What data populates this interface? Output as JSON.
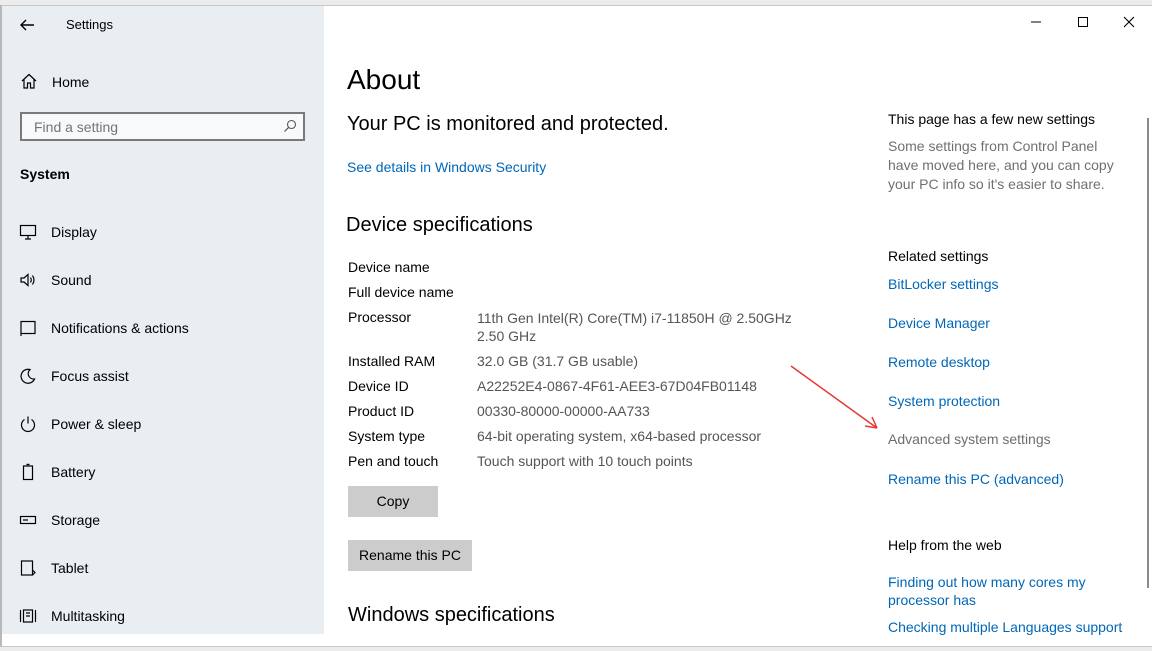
{
  "window": {
    "title": "Settings",
    "controls": {
      "minimize": "—",
      "maximize": "☐",
      "close": "✕"
    }
  },
  "sidebar": {
    "home_label": "Home",
    "search_placeholder": "Find a setting",
    "section_title": "System",
    "items": [
      {
        "label": "Display",
        "icon": "display-icon"
      },
      {
        "label": "Sound",
        "icon": "sound-icon"
      },
      {
        "label": "Notifications & actions",
        "icon": "notifications-icon"
      },
      {
        "label": "Focus assist",
        "icon": "focus-assist-icon"
      },
      {
        "label": "Power & sleep",
        "icon": "power-icon"
      },
      {
        "label": "Battery",
        "icon": "battery-icon"
      },
      {
        "label": "Storage",
        "icon": "storage-icon"
      },
      {
        "label": "Tablet",
        "icon": "tablet-icon"
      },
      {
        "label": "Multitasking",
        "icon": "multitasking-icon"
      }
    ]
  },
  "main": {
    "page_title": "About",
    "protection_status": "Your PC is monitored and protected.",
    "security_link": "See details in Windows Security",
    "device_specs_heading": "Device specifications",
    "specs": [
      {
        "label": "Device name",
        "value": ""
      },
      {
        "label": "Full device name",
        "value": ""
      },
      {
        "label": "Processor",
        "value": "11th Gen Intel(R) Core(TM) i7-11850H @ 2.50GHz",
        "value2": "2.50 GHz"
      },
      {
        "label": "Installed RAM",
        "value": "32.0 GB (31.7 GB usable)"
      },
      {
        "label": "Device ID",
        "value": "A22252E4-0867-4F61-AEE3-67D04FB01148"
      },
      {
        "label": "Product ID",
        "value": "00330-80000-00000-AA733"
      },
      {
        "label": "System type",
        "value": "64-bit operating system, x64-based processor"
      },
      {
        "label": "Pen and touch",
        "value": "Touch support with 10 touch points"
      }
    ],
    "copy_button": "Copy",
    "rename_button": "Rename this PC",
    "windows_specs_heading": "Windows specifications"
  },
  "right": {
    "new_settings_heading": "This page has a few new settings",
    "new_settings_text": "Some settings from Control Panel have moved here, and you can copy your PC info so it's easier to share.",
    "related_heading": "Related settings",
    "related_links": {
      "bitlocker": "BitLocker settings",
      "device_manager": "Device Manager",
      "remote_desktop": "Remote desktop",
      "system_protection": "System protection",
      "advanced": "Advanced system settings",
      "rename_advanced": "Rename this PC (advanced)"
    },
    "help_heading": "Help from the web",
    "help_links": {
      "cores": "Finding out how many cores my processor has",
      "languages": "Checking multiple Languages support"
    }
  },
  "colors": {
    "link": "#0067b8",
    "sidebar_bg": "#e9eef3",
    "button_bg": "#cccccc",
    "annotation_arrow": "#e53935"
  }
}
